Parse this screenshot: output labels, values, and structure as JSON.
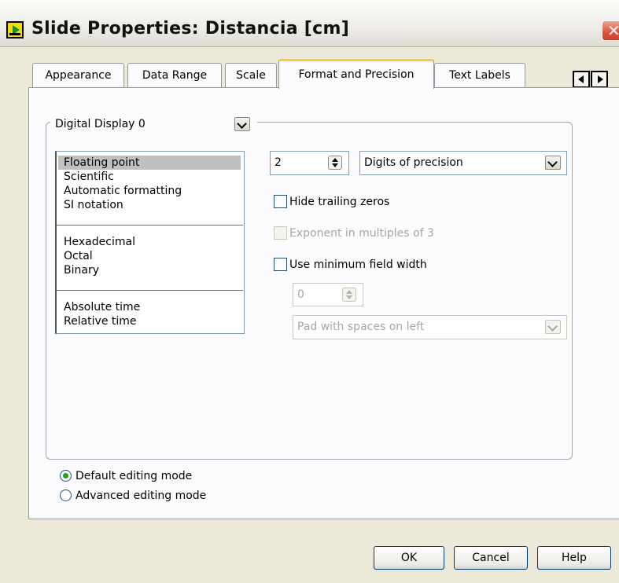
{
  "window": {
    "title": "Slide Properties: Distancia [cm]",
    "close_glyph": "✕"
  },
  "tabs": [
    {
      "label": "Appearance"
    },
    {
      "label": "Data Range"
    },
    {
      "label": "Scale"
    },
    {
      "label": "Format and Precision",
      "active": true
    },
    {
      "label": "Text Labels"
    }
  ],
  "display_select": {
    "value": "Digital Display 0"
  },
  "format_list": {
    "groups": [
      [
        "Floating point",
        "Scientific",
        "Automatic formatting",
        "SI notation"
      ],
      [
        "Hexadecimal",
        "Octal",
        "Binary"
      ],
      [
        "Absolute time",
        "Relative time"
      ]
    ],
    "selected": "Floating point"
  },
  "precision": {
    "digits_value": "2",
    "type_select": "Digits of precision"
  },
  "options": {
    "hide_trailing_zeros": {
      "label": "Hide trailing zeros",
      "checked": false,
      "enabled": true
    },
    "exponent_multiples_3": {
      "label": "Exponent in multiples of 3",
      "checked": false,
      "enabled": false
    },
    "use_min_field_width": {
      "label": "Use minimum field width",
      "checked": false,
      "enabled": true
    }
  },
  "field_width": {
    "value": "0",
    "pad_select": "Pad with spaces on left"
  },
  "editing_mode": {
    "default_label": "Default editing mode",
    "advanced_label": "Advanced editing mode",
    "selected": "default"
  },
  "buttons": {
    "ok": "OK",
    "cancel": "Cancel",
    "help": "Help"
  },
  "colors": {
    "dialog_bg": "#ece9d8",
    "tab_highlight": "#ffc83c",
    "selection_bg": "#c0c0c0",
    "radio_dot": "#21a121",
    "close_button": "#d9533a"
  }
}
